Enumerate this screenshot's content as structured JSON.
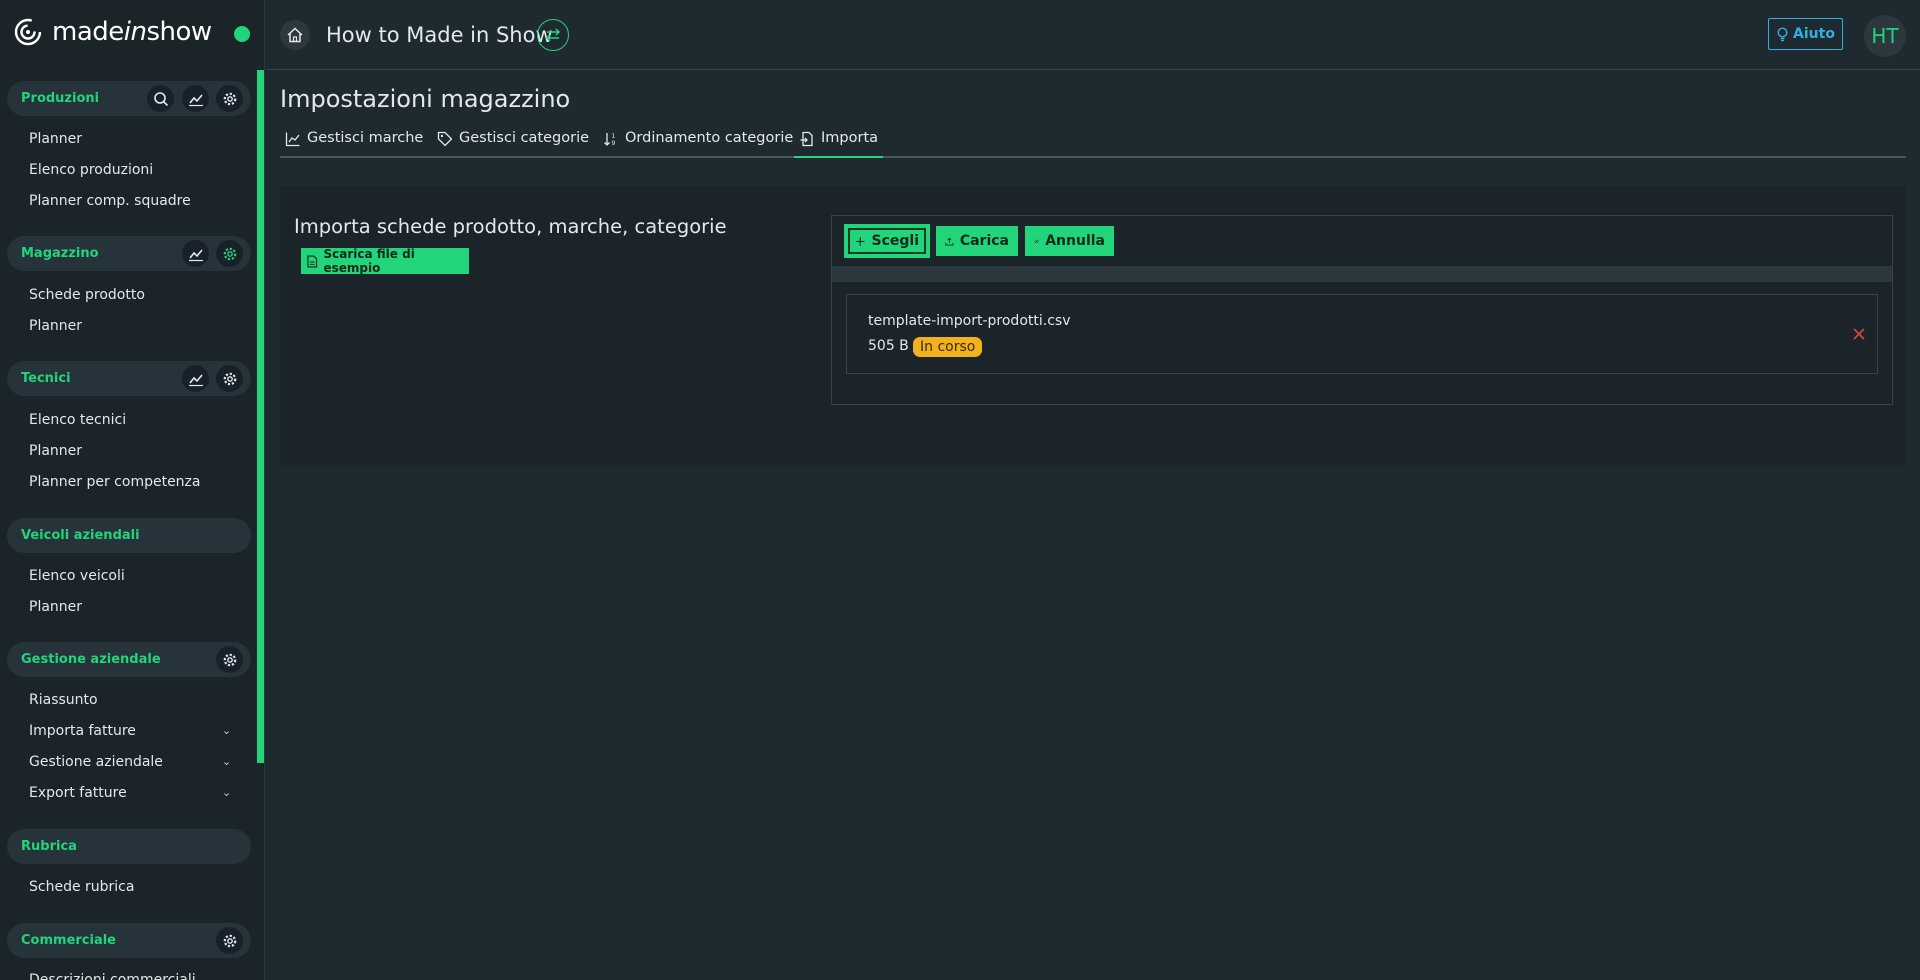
{
  "brand": {
    "logo_text_a": "made",
    "logo_text_b": "in",
    "logo_text_c": "show",
    "accent": "#22d47a"
  },
  "sidebar": {
    "sections": [
      {
        "title": "Produzioni",
        "items": [
          "Planner",
          "Elenco produzioni",
          "Planner comp. squadre"
        ]
      },
      {
        "title": "Magazzino",
        "items": [
          "Schede prodotto",
          "Planner"
        ]
      },
      {
        "title": "Tecnici",
        "items": [
          "Elenco tecnici",
          "Planner",
          "Planner per competenza"
        ]
      },
      {
        "title": "Veicoli aziendali",
        "items": [
          "Elenco veicoli",
          "Planner"
        ]
      },
      {
        "title": "Gestione aziendale",
        "items": [
          "Riassunto",
          "Importa fatture",
          "Gestione aziendale",
          "Export fatture"
        ]
      },
      {
        "title": "Rubrica",
        "items": [
          "Schede rubrica"
        ]
      },
      {
        "title": "Commerciale",
        "items": [
          "Descrizioni commerciali"
        ]
      }
    ]
  },
  "header": {
    "title": "How to Made in Show",
    "help_label": "Aiuto",
    "avatar_initials": "HT"
  },
  "page": {
    "title": "Impostazioni magazzino",
    "tabs": [
      {
        "label": "Gestisci marche",
        "icon": "chart-icon"
      },
      {
        "label": "Gestisci categorie",
        "icon": "tag-icon"
      },
      {
        "label": "Ordinamento categorie",
        "icon": "sort-icon"
      },
      {
        "label": "Importa",
        "icon": "file-import-icon",
        "active": true
      }
    ]
  },
  "import": {
    "title": "Importa schede prodotto, marche, categorie",
    "sample_button": "Scarica file di esempio",
    "choose_label": "Scegli",
    "upload_label": "Carica",
    "cancel_label": "Annulla",
    "file": {
      "name": "template-import-prodotti.csv",
      "size": "505 B",
      "status": "In corso"
    }
  }
}
